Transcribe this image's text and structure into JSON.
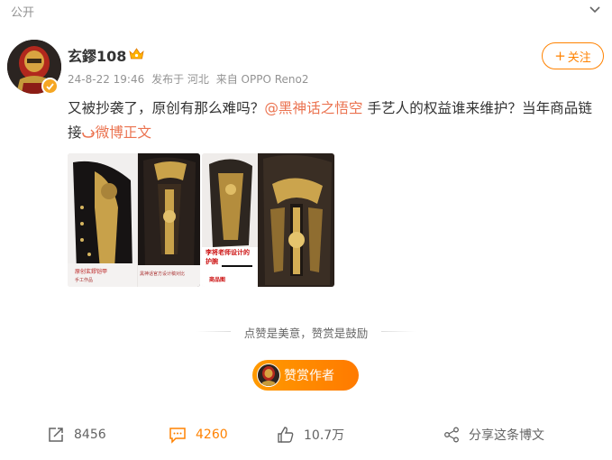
{
  "header": {
    "visibility": "公开"
  },
  "user": {
    "name": "玄鏐108"
  },
  "meta": {
    "time": "24-8-22 19:46",
    "location": "发布于 河北",
    "source": "来自 OPPO Reno2"
  },
  "follow": {
    "label": "关注"
  },
  "post": {
    "text_part1": "又被抄袭了，原创有那么难吗？",
    "mention": "@黑神话之悟空",
    "text_part2": " 手艺人的权益谁来维护？当年商品链接",
    "link_label": "微博正文"
  },
  "images": [
    {
      "caption_line1": "原创玄鏐铠甲",
      "caption_line2": "手工作品"
    },
    {
      "caption_line1": "黑神话官方设计稿对比",
      "caption_line2": ""
    },
    {
      "caption_line1": "李将老师设计的",
      "caption_line2": "护腕",
      "caption_line3": "商品图"
    },
    {
      "caption_line1": "",
      "caption_line2": ""
    }
  ],
  "encourage_text": "点赞是美意，赞赏是鼓励",
  "reward": {
    "label": "赞赏作者"
  },
  "actions": {
    "repost": "8456",
    "comment": "4260",
    "like": "10.7万",
    "share": "分享这条博文"
  },
  "colors": {
    "accent": "#ff8200",
    "link": "#eb7350",
    "muted": "#939393"
  }
}
